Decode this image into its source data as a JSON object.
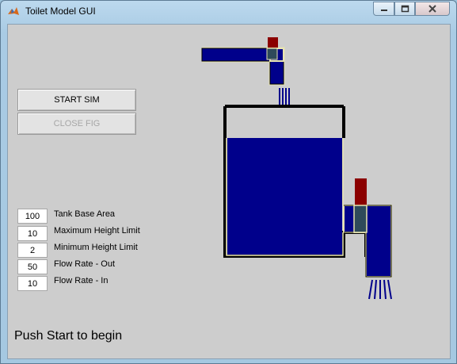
{
  "window": {
    "title": "Toilet Model GUI",
    "controls": [
      "minimize",
      "maximize",
      "close"
    ]
  },
  "buttons": {
    "start": "START SIM",
    "close_fig": "CLOSE FIG"
  },
  "parameters": [
    {
      "label": "Tank Base Area",
      "value": "100"
    },
    {
      "label": "Maximum Height Limit",
      "value": "10"
    },
    {
      "label": "Minimum Height Limit",
      "value": "2"
    },
    {
      "label": "Flow Rate - Out",
      "value": "50"
    },
    {
      "label": "Flow Rate - In",
      "value": "10"
    }
  ],
  "status": "Push Start to begin",
  "tank": {
    "water_level_fraction": 0.8,
    "water_color": "#00008b",
    "valve_color": "#8b0000",
    "valve_body_color": "#2e4a5a",
    "pipe_outline_color": "#e8e4b0"
  }
}
